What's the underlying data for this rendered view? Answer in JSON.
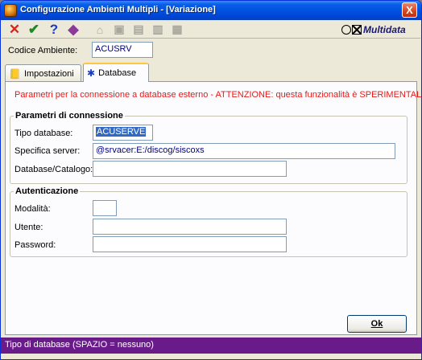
{
  "window": {
    "title": "Configurazione Ambienti Multipli - [Variazione]",
    "close_glyph": "X"
  },
  "toolbar": {
    "buttons": [
      {
        "icon": "cancel-icon",
        "glyph": "✕",
        "color": "#d8241c"
      },
      {
        "icon": "confirm-icon",
        "glyph": "✔",
        "color": "#1b8a22"
      },
      {
        "icon": "help-icon",
        "glyph": "?",
        "color": "#1a3cc8"
      },
      {
        "icon": "tools-icon",
        "glyph": "◆",
        "color": "#8b3a9a"
      }
    ],
    "disabled_glyphs": [
      "⌂",
      "▣",
      "▤",
      "▥",
      "▦"
    ],
    "logo_text": "Multidata"
  },
  "codice": {
    "label": "Codice Ambiente:",
    "value": "ACUSRV"
  },
  "tabs": [
    {
      "label": "Impostazioni",
      "active": false
    },
    {
      "label": "Database",
      "active": true
    }
  ],
  "warning": "Parametri per la connessione a database esterno - ATTENZIONE: questa funzionalità è SPERIMENTALE!",
  "connessione": {
    "title": "Parametri di connessione",
    "tipo_label": "Tipo database:",
    "tipo_value": "ACUSERVE",
    "server_label": "Specifica server:",
    "server_value": "@srvacer:E:/discog/siscoxs",
    "catalogo_label": "Database/Catalogo:",
    "catalogo_value": ""
  },
  "autenticazione": {
    "title": "Autenticazione",
    "modalita_label": "Modalità:",
    "modalita_value": "",
    "utente_label": "Utente:",
    "utente_value": "",
    "password_label": "Password:",
    "password_value": ""
  },
  "ok_label": "Ok",
  "status": "Tipo di database (SPAZIO = nessuno)"
}
